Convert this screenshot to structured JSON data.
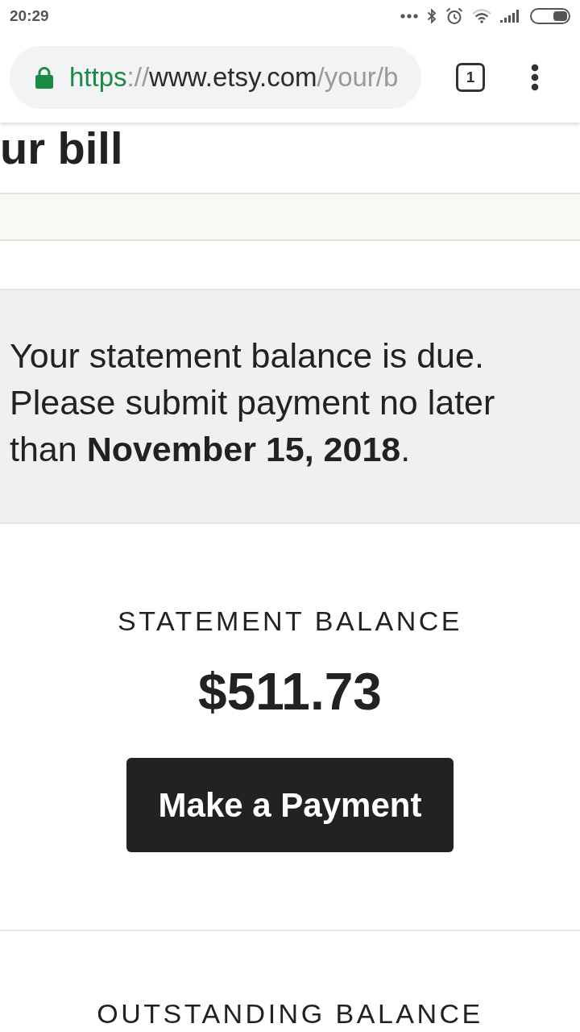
{
  "status_bar": {
    "time": "20:29"
  },
  "browser": {
    "secure": true,
    "url": [
      {
        "text": "https",
        "kind": "scheme"
      },
      {
        "text": "://",
        "kind": "separator"
      },
      {
        "text": "www.etsy.com",
        "kind": "host"
      },
      {
        "text": "/your/b",
        "kind": "path"
      }
    ],
    "tab_count": "1"
  },
  "page": {
    "heading": "ur bill",
    "notice": "Your statement balance is due. Please submit payment no later than **November 15, 2018**.",
    "statement": {
      "label": "STATEMENT BALANCE",
      "amount": "$511.73",
      "button": "Make a Payment"
    },
    "outstanding": {
      "label": "OUTSTANDING BALANCE"
    }
  }
}
